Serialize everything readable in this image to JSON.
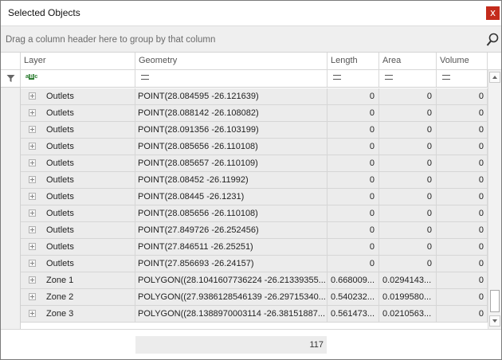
{
  "window": {
    "title": "Selected Objects",
    "close_label": "x"
  },
  "groupbar": {
    "hint": "Drag a column header here to group by that column"
  },
  "columns": {
    "layer": "Layer",
    "geometry": "Geometry",
    "length": "Length",
    "area": "Area",
    "volume": "Volume"
  },
  "rows": [
    {
      "layer": "Outlets",
      "geometry": "POINT(28.084595 -26.121639)",
      "length": "0",
      "area": "0",
      "volume": "0"
    },
    {
      "layer": "Outlets",
      "geometry": "POINT(28.088142 -26.108082)",
      "length": "0",
      "area": "0",
      "volume": "0"
    },
    {
      "layer": "Outlets",
      "geometry": "POINT(28.091356 -26.103199)",
      "length": "0",
      "area": "0",
      "volume": "0"
    },
    {
      "layer": "Outlets",
      "geometry": "POINT(28.085656 -26.110108)",
      "length": "0",
      "area": "0",
      "volume": "0"
    },
    {
      "layer": "Outlets",
      "geometry": "POINT(28.085657 -26.110109)",
      "length": "0",
      "area": "0",
      "volume": "0"
    },
    {
      "layer": "Outlets",
      "geometry": "POINT(28.08452 -26.11992)",
      "length": "0",
      "area": "0",
      "volume": "0"
    },
    {
      "layer": "Outlets",
      "geometry": "POINT(28.08445 -26.1231)",
      "length": "0",
      "area": "0",
      "volume": "0"
    },
    {
      "layer": "Outlets",
      "geometry": "POINT(28.085656 -26.110108)",
      "length": "0",
      "area": "0",
      "volume": "0"
    },
    {
      "layer": "Outlets",
      "geometry": "POINT(27.849726 -26.252456)",
      "length": "0",
      "area": "0",
      "volume": "0"
    },
    {
      "layer": "Outlets",
      "geometry": "POINT(27.846511 -26.25251)",
      "length": "0",
      "area": "0",
      "volume": "0"
    },
    {
      "layer": "Outlets",
      "geometry": "POINT(27.856693 -26.24157)",
      "length": "0",
      "area": "0",
      "volume": "0"
    },
    {
      "layer": "Zone 1",
      "geometry": "POLYGON((28.1041607736224 -26.21339355...",
      "length": "0.668009...",
      "area": "0.0294143...",
      "volume": "0"
    },
    {
      "layer": "Zone 2",
      "geometry": "POLYGON((27.9386128546139 -26.29715340...",
      "length": "0.540232...",
      "area": "0.0199580...",
      "volume": "0"
    },
    {
      "layer": "Zone 3",
      "geometry": "POLYGON((28.1388970003114 -26.38151887...",
      "length": "0.561473...",
      "area": "0.0210563...",
      "volume": "0"
    }
  ],
  "footer": {
    "count": "117"
  },
  "icons": {
    "search": "search-icon",
    "filter": "funnel-icon",
    "abc": "text-filter-icon",
    "equals": "equals-icon",
    "expand": "plus-box-icon"
  }
}
